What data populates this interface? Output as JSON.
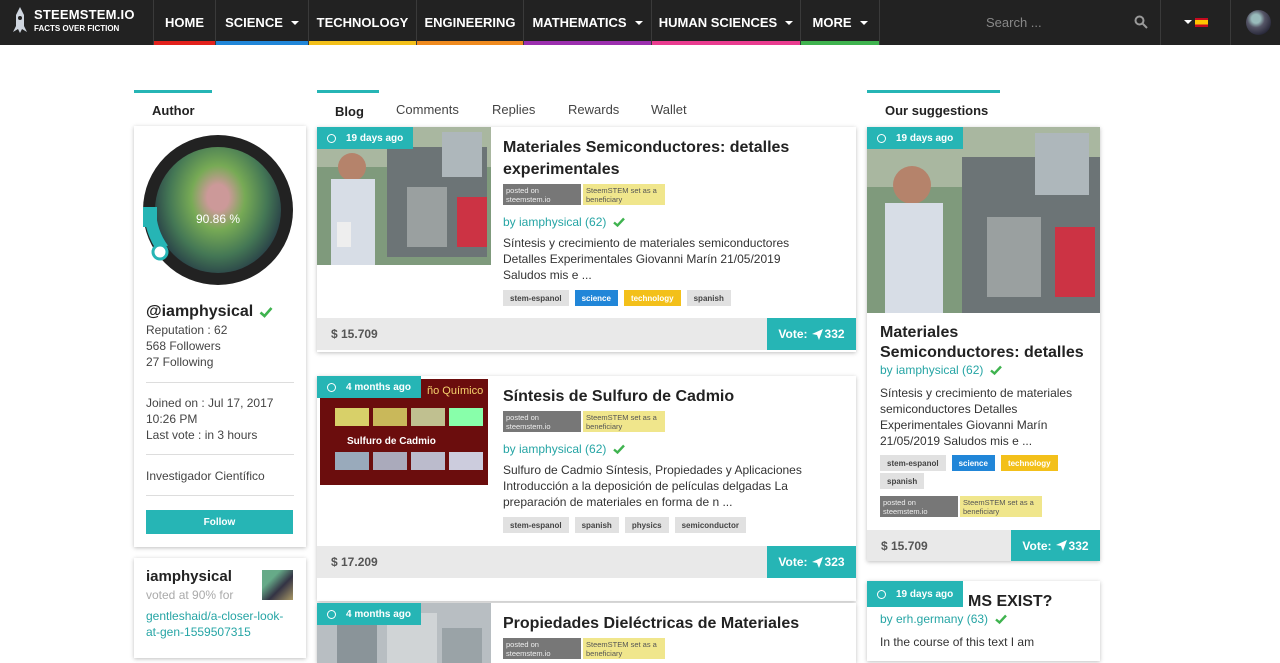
{
  "nav": {
    "logo_title": "STEEMSTEM.IO",
    "logo_sub": "FACTS OVER FICTION",
    "items": [
      {
        "label": "HOME",
        "color": "#e2211c",
        "dropdown": false
      },
      {
        "label": "SCIENCE",
        "color": "#2186d8",
        "dropdown": true
      },
      {
        "label": "TECHNOLOGY",
        "color": "#f3c01a",
        "dropdown": false
      },
      {
        "label": "ENGINEERING",
        "color": "#ef8a1e",
        "dropdown": false
      },
      {
        "label": "MATHEMATICS",
        "color": "#9b2fae",
        "dropdown": true
      },
      {
        "label": "HUMAN SCIENCES",
        "color": "#e93c8f",
        "dropdown": true
      },
      {
        "label": "MORE",
        "color": "#3fb34f",
        "dropdown": true
      }
    ],
    "search_placeholder": "Search ..."
  },
  "author": {
    "section_label": "Author",
    "reputation_percent": "90.86 %",
    "username": "@iamphysical",
    "reputation": "Reputation : 62",
    "followers": "568 Followers",
    "following": "27 Following",
    "joined": "Joined on : Jul 17, 2017",
    "joined_time": "10:26 PM",
    "last_vote": "Last vote : in 3 hours",
    "about": "Investigador Científico",
    "follow_label": "Follow"
  },
  "voted": {
    "name": "iamphysical",
    "voted_at": "voted at 90% for",
    "link": "gentleshaid/a-closer-look-at-gen-1559507315"
  },
  "tabs": [
    "Blog",
    "Comments",
    "Replies",
    "Rewards",
    "Wallet"
  ],
  "badges": {
    "posted": "posted on steemstem.io",
    "beneficiary": "SteemSTEM set as a beneficiary"
  },
  "posts": [
    {
      "age": "19 days ago",
      "title": "Materiales Semiconductores: detalles experimentales",
      "byline": "by iamphysical (62)",
      "excerpt": "Síntesis y crecimiento de materiales semiconductores Detalles Experimentales Giovanni Marín 21/05/2019 Saludos mis e ...",
      "tags": [
        {
          "label": "stem-espanol",
          "style": "grey"
        },
        {
          "label": "science",
          "style": "blue"
        },
        {
          "label": "technology",
          "style": "yellow"
        },
        {
          "label": "spanish",
          "style": "grey"
        }
      ],
      "payout": "$ 15.709",
      "vote_label": "Vote:",
      "votes": "332"
    },
    {
      "age": "4 months ago",
      "title": "Síntesis de Sulfuro de Cadmio",
      "byline": "by iamphysical (62)",
      "excerpt": "Sulfuro de Cadmio Síntesis, Propiedades y Aplicaciones Introducción a la deposición de películas delgadas La preparación de materiales en forma de n ...",
      "tags": [
        {
          "label": "stem-espanol",
          "style": "grey"
        },
        {
          "label": "spanish",
          "style": "grey"
        },
        {
          "label": "physics",
          "style": "grey"
        },
        {
          "label": "semiconductor",
          "style": "grey"
        }
      ],
      "payout": "$ 17.209",
      "vote_label": "Vote:",
      "votes": "323",
      "thumb_text_top": "ño Químico",
      "thumb_text_mid": "Sulfuro de Cadmio"
    },
    {
      "age": "4 months ago",
      "title": "Propiedades Dieléctricas de Materiales"
    }
  ],
  "suggestions": {
    "section_label": "Our suggestions",
    "card1": {
      "age": "19 days ago",
      "title": "Materiales Semiconductores: detalles",
      "byline": "by iamphysical (62)",
      "excerpt": "Síntesis y crecimiento de materiales semiconductores Detalles Experimentales Giovanni Marín 21/05/2019 Saludos mis e ...",
      "tags": [
        {
          "label": "stem-espanol",
          "style": "grey"
        },
        {
          "label": "science",
          "style": "blue"
        },
        {
          "label": "technology",
          "style": "yellow"
        },
        {
          "label": "spanish",
          "style": "grey"
        }
      ],
      "payout": "$ 15.709",
      "vote_label": "Vote:",
      "votes": "332"
    },
    "card2": {
      "age": "19 days ago",
      "title_partial": "MS EXIST?",
      "byline": "by erh.germany (63)",
      "excerpt": "In the course of this text I am"
    }
  },
  "colors": {
    "accent": "#26b5b5",
    "nav_bg": "#222222",
    "verified": "#3fb34f"
  }
}
